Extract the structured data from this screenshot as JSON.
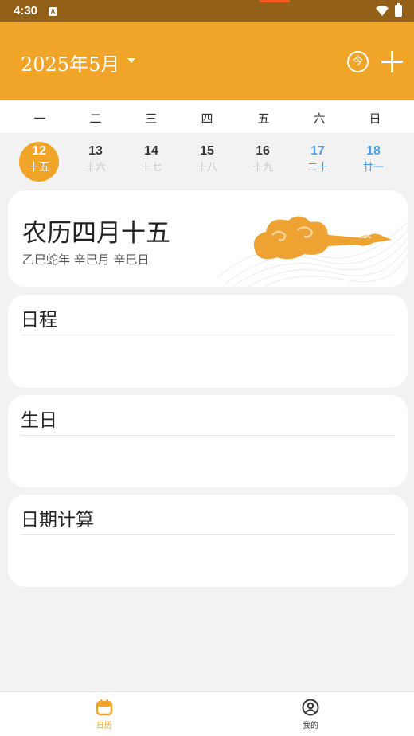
{
  "status": {
    "time": "4:30",
    "notification_icon": "A"
  },
  "header": {
    "title": "2025年5月",
    "today_label": "今"
  },
  "weekdays": [
    "一",
    "二",
    "三",
    "四",
    "五",
    "六",
    "日"
  ],
  "days": [
    {
      "num": "12",
      "lunar": "十五",
      "selected": true,
      "weekend": false
    },
    {
      "num": "13",
      "lunar": "十六",
      "selected": false,
      "weekend": false
    },
    {
      "num": "14",
      "lunar": "十七",
      "selected": false,
      "weekend": false
    },
    {
      "num": "15",
      "lunar": "十八",
      "selected": false,
      "weekend": false
    },
    {
      "num": "16",
      "lunar": "十九",
      "selected": false,
      "weekend": false
    },
    {
      "num": "17",
      "lunar": "二十",
      "selected": false,
      "weekend": true
    },
    {
      "num": "18",
      "lunar": "廿一",
      "selected": false,
      "weekend": true
    }
  ],
  "lunar": {
    "title": "农历四月十五",
    "subtitle": "乙巳蛇年  辛巳月  辛巳日"
  },
  "sections": {
    "schedule": "日程",
    "birthday": "生日",
    "date_calc": "日期计算"
  },
  "nav": {
    "calendar": "日历",
    "mine": "我的"
  },
  "colors": {
    "accent": "#f0a428",
    "weekend": "#4a9ee8",
    "status_bar": "#926019"
  }
}
